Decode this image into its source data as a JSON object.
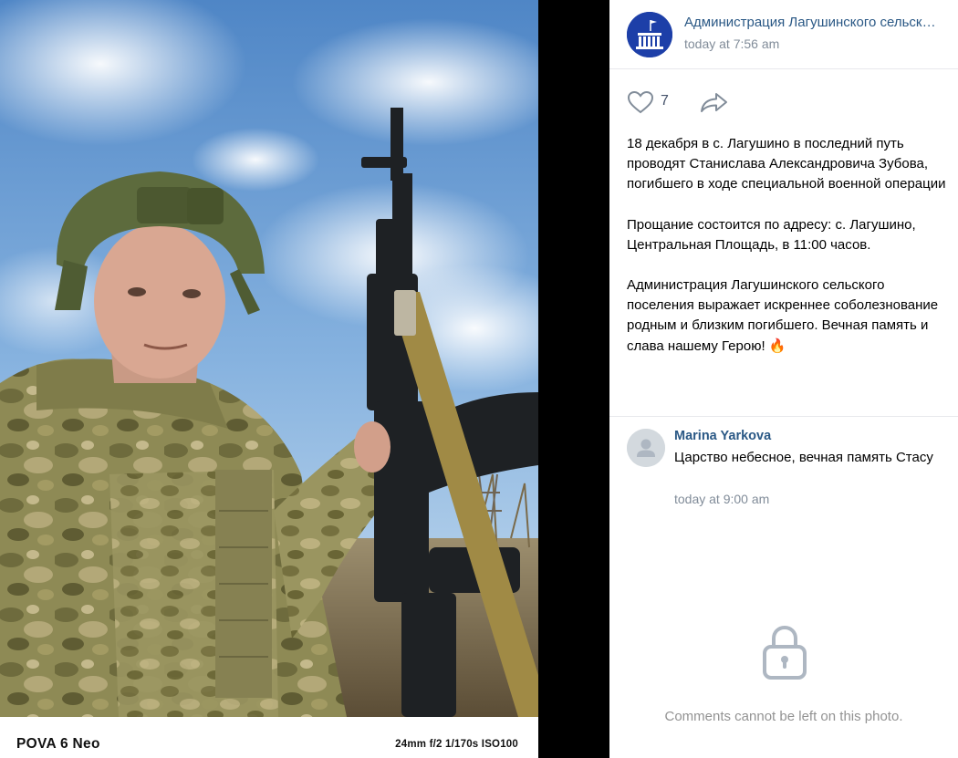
{
  "photo": {
    "camera_model": "POVA 6 Neo",
    "exif": "24mm  f/2  1/170s  ISO100"
  },
  "post": {
    "group_name": "Администрация Лагушинского сельского поселения",
    "time": "today at 7:56 am",
    "likes": "7",
    "paragraphs": [
      "18 декабря в с. Лагушино в последний путь проводят Станислава Александровича Зубова, погибшего в ходе специальной военной операции",
      "Прощание состоится по адресу: с. Лагушино, Центральная Площадь, в 11:00 часов.",
      "Администрация Лагушинского сельского поселения выражает искреннее соболезнование родным и близким погибшего. Вечная память и слава нашему Герою!"
    ],
    "emoji": "🔥"
  },
  "comment": {
    "author": "Marina Yarkova",
    "text": "Царство небесное, вечная память Стасу",
    "time": "today at 9:00 am"
  },
  "comments_locked_message": "Comments cannot be left on this photo.",
  "icons": {
    "like": "heart-icon",
    "share": "share-icon",
    "lock": "lock-icon",
    "group_avatar": "building-flag-icon",
    "user_avatar": "default-user-icon"
  },
  "colors": {
    "link": "#2a5885",
    "secondary_text": "#818c99",
    "group_avatar_bg": "#1d3fa8",
    "muted_icon": "#aeb7c2"
  }
}
